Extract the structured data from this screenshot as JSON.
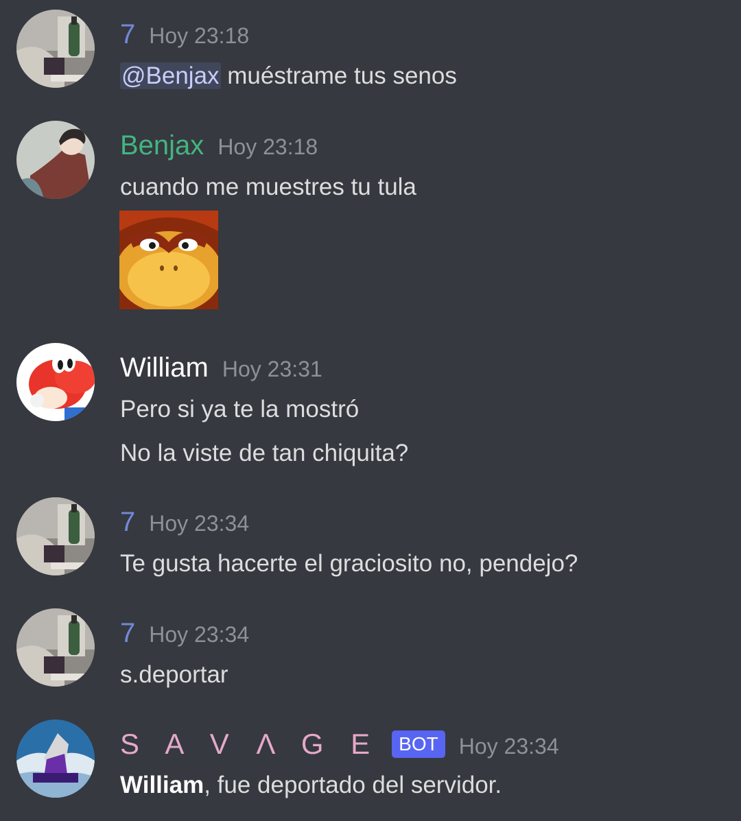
{
  "colors": {
    "background": "#36393f",
    "user_7": "#7289da",
    "user_benjax": "#43b581",
    "user_william": "#ffffff",
    "user_savage": "#e4a9c9",
    "timestamp": "#8e9297",
    "bot_tag": "#5865f2"
  },
  "messages": [
    {
      "username": "7",
      "timestamp": "Hoy 23:18",
      "avatar_icon": "bottle-photo-avatar",
      "mention": "@Benjax",
      "text": " muéstrame tus senos"
    },
    {
      "username": "Benjax",
      "timestamp": "Hoy 23:18",
      "avatar_icon": "anime-character-avatar",
      "text": "cuando me muestres tu tula",
      "attachment": "donkey-kong-face-emoji"
    },
    {
      "username": "William",
      "timestamp": "Hoy 23:31",
      "avatar_icon": "red-yoshi-avatar",
      "lines": [
        "Pero si ya te la mostró",
        "No la viste de tan chiquita?"
      ]
    },
    {
      "username": "7",
      "timestamp": "Hoy 23:34",
      "avatar_icon": "bottle-photo-avatar",
      "text": "Te gusta hacerte el graciosito no, pendejo?"
    },
    {
      "username": "7",
      "timestamp": "Hoy 23:34",
      "avatar_icon": "bottle-photo-avatar",
      "text": "s.deportar"
    },
    {
      "username": "S A V Λ G E",
      "bot_tag": "BOT",
      "timestamp": "Hoy 23:34",
      "avatar_icon": "wolf-logo-avatar",
      "bold_text": "William",
      "text": ", fue deportado del servidor."
    }
  ]
}
